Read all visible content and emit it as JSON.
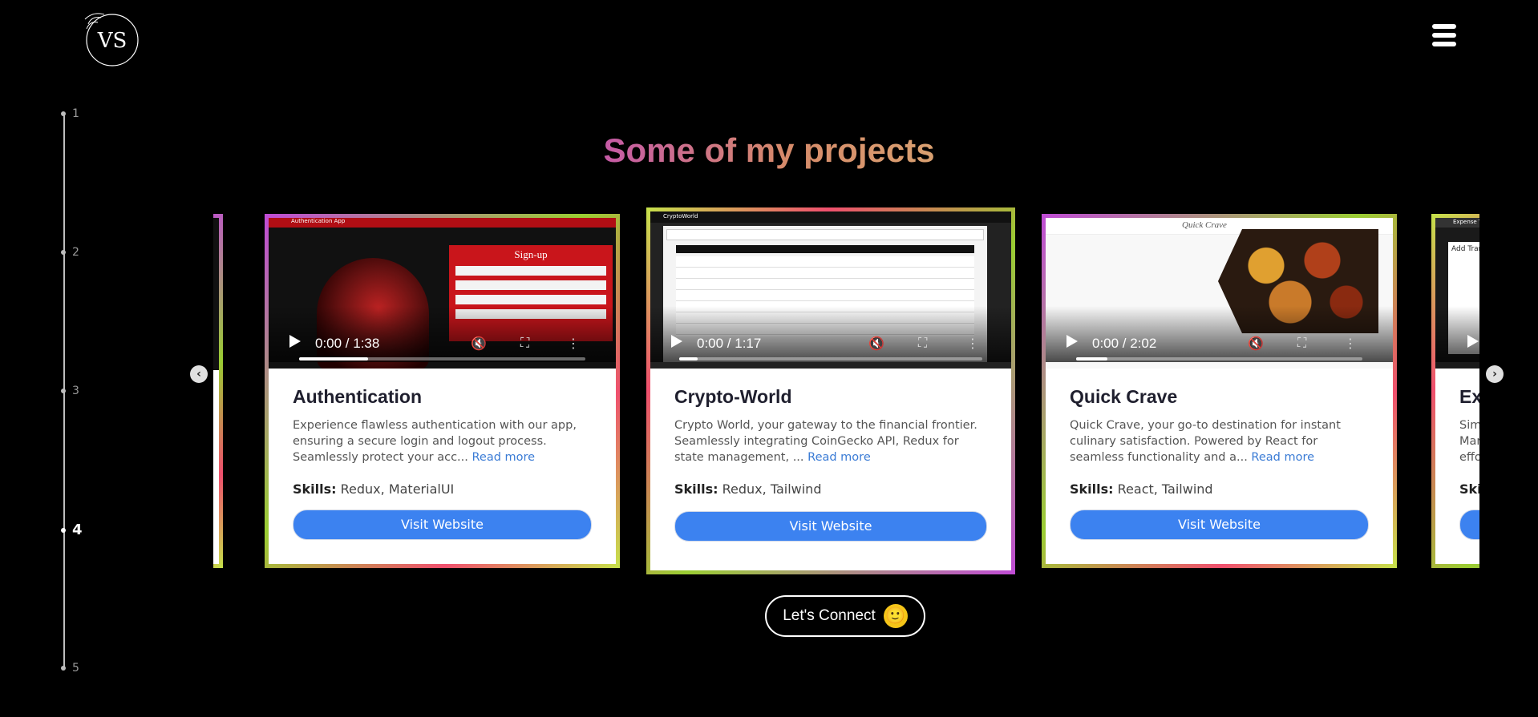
{
  "brand": {
    "logo_text": "VS"
  },
  "timeline": {
    "steps": [
      "1",
      "2",
      "3",
      "4",
      "5"
    ],
    "active": "4"
  },
  "section": {
    "title": "Some of my projects"
  },
  "projects": [
    {
      "title": "Authentication",
      "video_time": "0:00 / 1:38",
      "video_progress": 0.24,
      "thumb_header": "Authentication App",
      "signup_label": "Sign-up",
      "description": "Experience flawless authentication with our app, ensuring a secure login and logout process. Seamlessly protect your acc...",
      "read_more": "Read more",
      "skills_label": "Skills:",
      "skills": "Redux, MaterialUI",
      "button": "Visit Website"
    },
    {
      "title": "Crypto-World",
      "video_time": "0:00 / 1:17",
      "video_progress": 0.06,
      "thumb_header": "CryptoWorld",
      "description": "Crypto World, your gateway to the financial frontier. Seamlessly integrating CoinGecko API, Redux for state management, ...",
      "read_more": "Read more",
      "skills_label": "Skills:",
      "skills": "Redux, Tailwind",
      "button": "Visit Website"
    },
    {
      "title": "Quick Crave",
      "video_time": "0:00 / 2:02",
      "video_progress": 0.11,
      "thumb_header": "Quick Crave",
      "description": "Quick Crave, your go-to destination for instant culinary satisfaction. Powered by React for seamless functionality and a...",
      "read_more": "Read more",
      "skills_label": "Skills:",
      "skills": "React, Tailwind",
      "button": "Visit Website"
    },
    {
      "title": "Ex",
      "description_lines": [
        "Sim",
        "Mar",
        "effo"
      ],
      "skills_label": "Ski",
      "thumb_header": "Expense Tr",
      "thumb_text": "Add Trans"
    }
  ],
  "connect": {
    "label": "Let's Connect",
    "emoji": "🙂"
  },
  "colors": {
    "accent": "#3c82f0",
    "title_gradient_start": "#c55aa6",
    "title_gradient_end": "#d9a070"
  }
}
